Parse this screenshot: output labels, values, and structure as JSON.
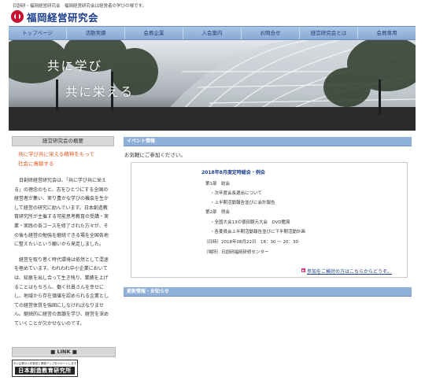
{
  "header": {
    "tagline": "日創研・福岡経営研究会　福岡経営研究会は経営者の学びの場です。",
    "org_name": "福岡経営研究会"
  },
  "nav": {
    "items": [
      "トップページ",
      "活動実績",
      "会員企業",
      "入会案内",
      "お問合せ",
      "経営研究会とは",
      "会員専用"
    ]
  },
  "hero": {
    "line1": "共に学び",
    "line2": "共に栄える"
  },
  "sidebar": {
    "heading": "経営研究会の概要",
    "highlight_line1": "共に学び共に栄える精神をもって",
    "highlight_line2": "社会に貢献する",
    "para1": "日創研経営研究会は、「共に学び共に栄える」の理念のもと、志をひとつにする全国の経営者が集い、実り豊かな学びの機会を生かして経営の研究に励んでいます。日本創造教育研究所が主催する可能思考教育の受講・実業・実践の各コースを修了された方々が、その後も経営の勉強を継続できる場を全国各地に整えたいという願いから発足しました。",
    "para2": "経営を取り巻く時代環境は依然として混迷を極めています。われわれ中小企業においては、知恵を出し合って生き残り、業績を上げることはもちろん、働く社員さんを幸せにし、地域から存在価値を認められる企業としての経営体質を強固にしなければなりません。継続的に経営の真髄を学び、経営を深めていくことが欠かせないのです。"
  },
  "link_section": {
    "heading": "■ LINK ■",
    "banner_small": "中小企業の人材育成と業績アップをサポートします",
    "banner_main": "日本創造教育研究所"
  },
  "event": {
    "section_title": "イベント情報",
    "welcome": "お気軽にご参加ください。",
    "title": "2018年8月度定時総会・例会",
    "lines": [
      "第1部　総会",
      "・次年度会長選出について",
      "・上半期活動報告並びに会計報告",
      "第2部　例会",
      "・全国大会13の徳田朝元大会　DVD鑑賞",
      "・各委員会上半期活動報告並びに下半期活動計画",
      "（日時）2018年08月22日　18：30 ～ 20：30",
      "（場所）日創研福岡研修センター"
    ],
    "link": "参加をご検討の方はこちらからどうぞ。"
  },
  "updates": {
    "section_title": "更新情報・お知らせ"
  },
  "colors": {
    "nav_bg": "#8fb0d8",
    "accent_red": "#e8561c",
    "brand_blue": "#1a3e8c"
  }
}
